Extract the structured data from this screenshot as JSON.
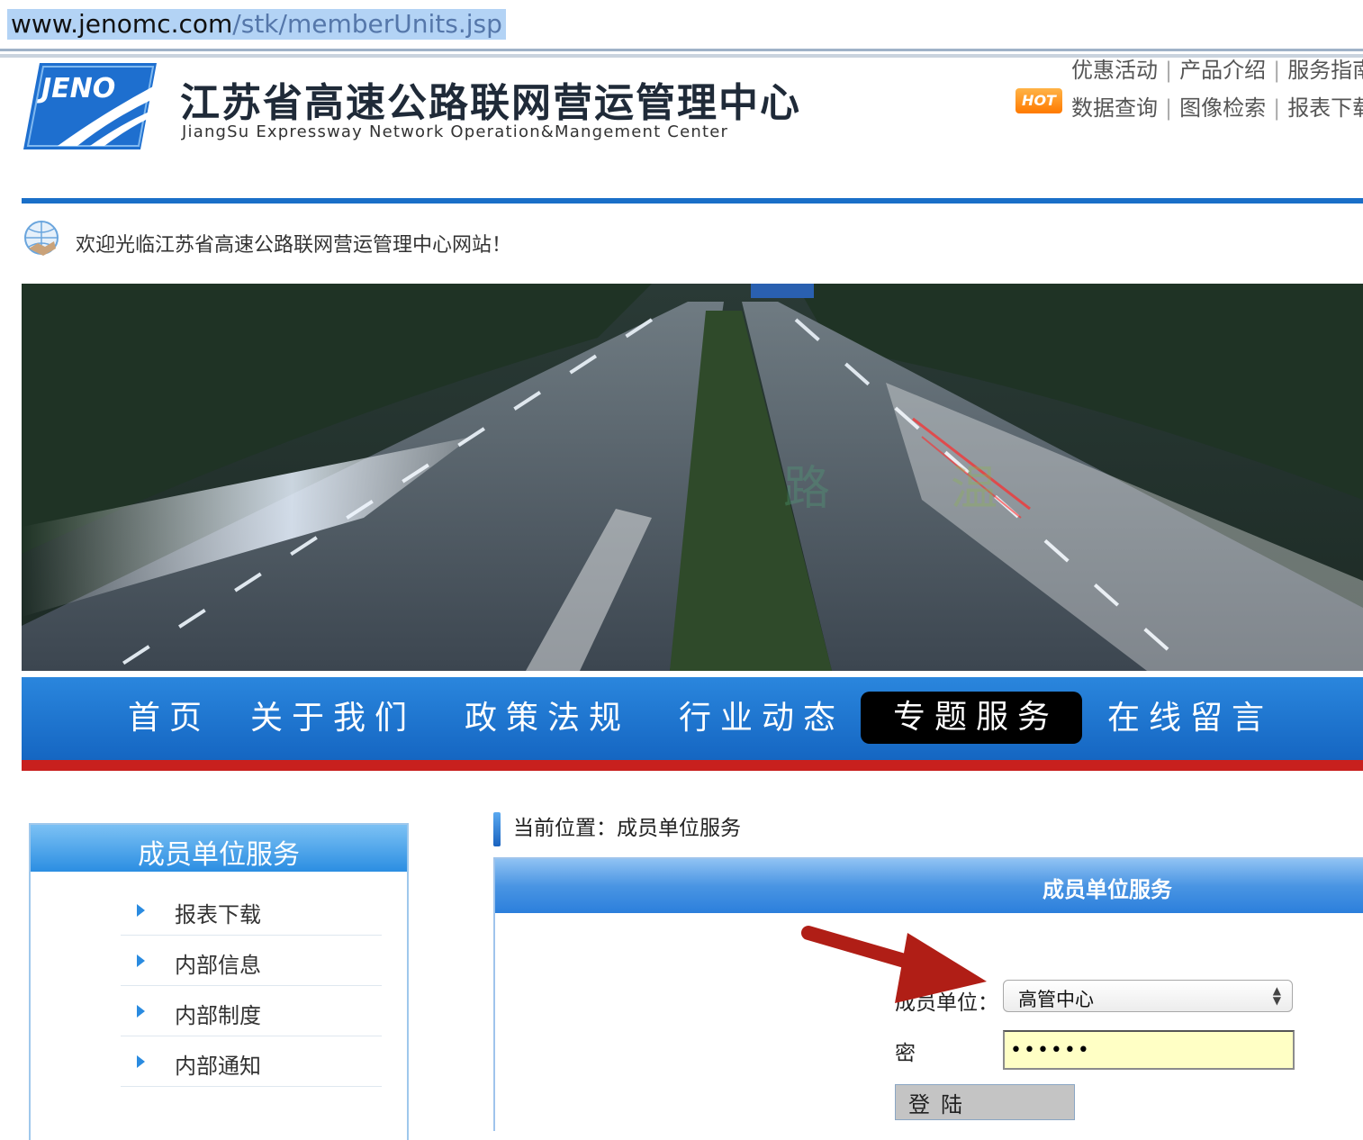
{
  "url": {
    "domain": "www.jenomc.com",
    "path": "/stk/memberUnits.jsp"
  },
  "header": {
    "logo_text": "JENO",
    "title": "江苏省高速公路联网营运管理中心",
    "subtitle": "JiangSu Expressway Network Operation&Mangement Center",
    "hot_badge": "HOT",
    "top_links_row1": [
      "优惠活动",
      "产品介绍",
      "服务指南"
    ],
    "top_links_row2": [
      "数据查询",
      "图像检索",
      "报表下载"
    ]
  },
  "welcome": "欢迎光临江苏省高速公路联网营运管理中心网站！",
  "banner": {
    "watermark": [
      "路",
      "温"
    ]
  },
  "nav": {
    "items": [
      "首页",
      "关于我们",
      "政策法规",
      "行业动态",
      "专题服务",
      "在线留言"
    ],
    "active": "专题服务"
  },
  "sidebar": {
    "title": "成员单位服务",
    "items": [
      "报表下载",
      "内部信息",
      "内部制度",
      "内部通知"
    ]
  },
  "breadcrumb": "当前位置：成员单位服务",
  "panel": {
    "title": "成员单位服务",
    "unit_label": "成员单位：",
    "unit_value": "高管中心",
    "password_label": "密",
    "password_value": "••••••",
    "login_label": "登陆"
  },
  "colors": {
    "accent_blue": "#1a6fc8",
    "nav_red": "#c8201e",
    "annotation_arrow": "#b01e16"
  }
}
